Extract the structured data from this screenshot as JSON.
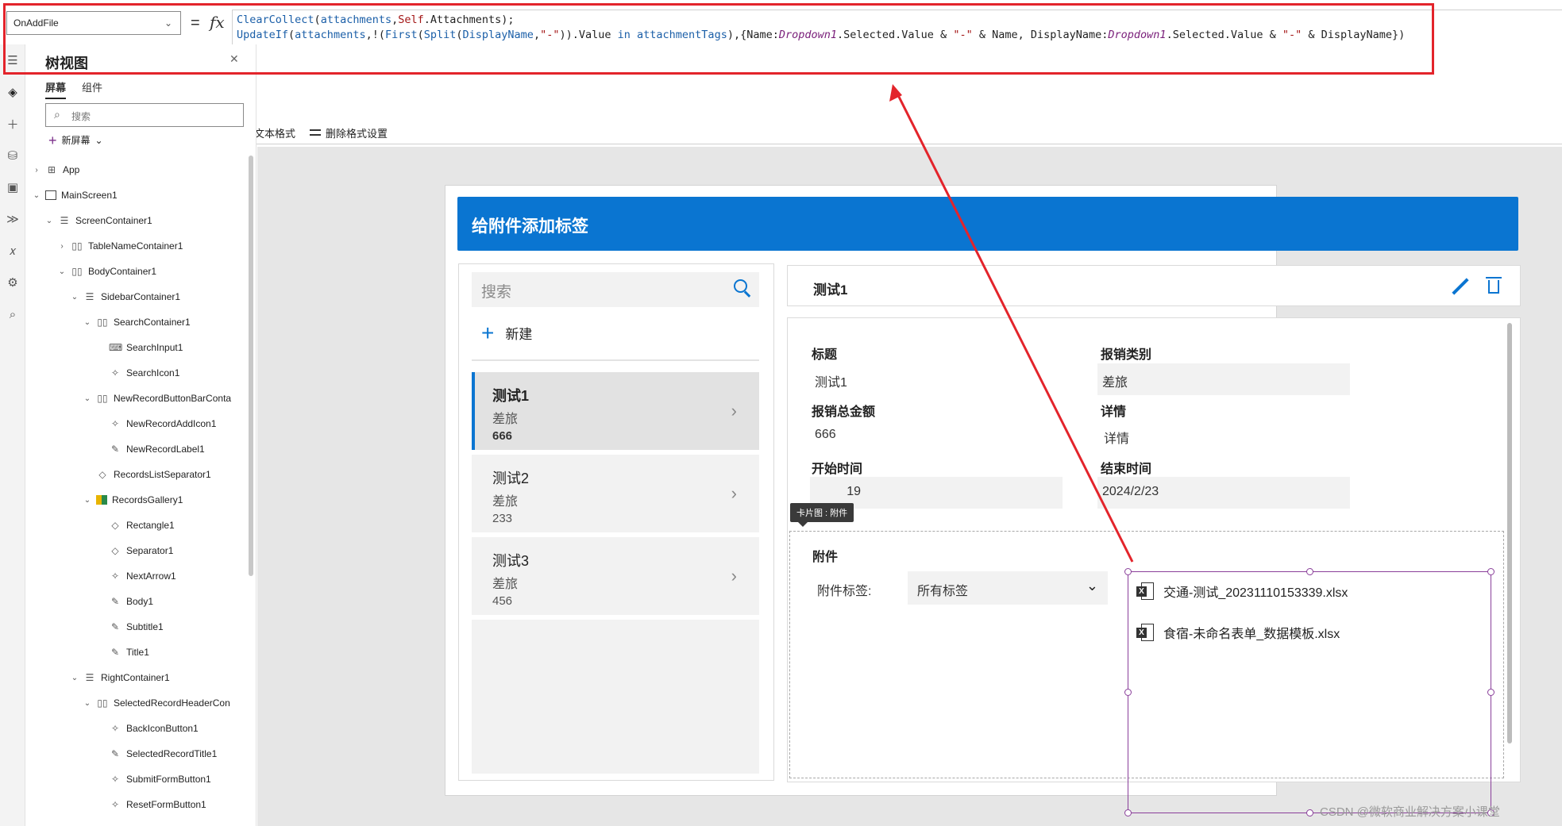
{
  "formula_bar": {
    "property": "OnAddFile",
    "equals": "=",
    "fx": "fx",
    "line1": [
      {
        "t": "ClearCollect",
        "c": "fn"
      },
      {
        "t": "(",
        "c": "plain"
      },
      {
        "t": "attachments",
        "c": "fn"
      },
      {
        "t": ",",
        "c": "plain"
      },
      {
        "t": "Self",
        "c": "str"
      },
      {
        "t": ".Attachments);",
        "c": "plain"
      }
    ],
    "line2": [
      {
        "t": "UpdateIf",
        "c": "fn"
      },
      {
        "t": "(",
        "c": "plain"
      },
      {
        "t": "attachments",
        "c": "fn"
      },
      {
        "t": ",!(",
        "c": "plain"
      },
      {
        "t": "First",
        "c": "fn"
      },
      {
        "t": "(",
        "c": "plain"
      },
      {
        "t": "Split",
        "c": "fn"
      },
      {
        "t": "(",
        "c": "plain"
      },
      {
        "t": "DisplayName",
        "c": "fn"
      },
      {
        "t": ",",
        "c": "plain"
      },
      {
        "t": "\"-\"",
        "c": "str"
      },
      {
        "t": ")).Value ",
        "c": "plain"
      },
      {
        "t": "in",
        "c": "kw"
      },
      {
        "t": " ",
        "c": "plain"
      },
      {
        "t": "attachmentTags",
        "c": "fn"
      },
      {
        "t": "),{Name:",
        "c": "plain"
      },
      {
        "t": "Dropdown1",
        "c": "ctl"
      },
      {
        "t": ".Selected.Value & ",
        "c": "plain"
      },
      {
        "t": "\"-\"",
        "c": "str"
      },
      {
        "t": " & Name, DisplayName:",
        "c": "plain"
      },
      {
        "t": "Dropdown1",
        "c": "ctl"
      },
      {
        "t": ".Selected.Value & ",
        "c": "plain"
      },
      {
        "t": "\"-\"",
        "c": "str"
      },
      {
        "t": " & DisplayName})",
        "c": "plain"
      }
    ],
    "format_text": "文本格式",
    "remove_format": "删除格式设置"
  },
  "tree": {
    "title": "树视图",
    "tabs": [
      "屏幕",
      "组件"
    ],
    "search_placeholder": "搜索",
    "new_screen": "新屏幕",
    "nodes": [
      {
        "label": "App",
        "indent": 0,
        "caret": "›",
        "icon": "app"
      },
      {
        "label": "MainScreen1",
        "indent": 0,
        "caret": "⌄",
        "icon": "screen"
      },
      {
        "label": "ScreenContainer1",
        "indent": 1,
        "caret": "⌄",
        "icon": "vcontainer"
      },
      {
        "label": "TableNameContainer1",
        "indent": 2,
        "caret": "›",
        "icon": "hcontainer"
      },
      {
        "label": "BodyContainer1",
        "indent": 2,
        "caret": "⌄",
        "icon": "hcontainer"
      },
      {
        "label": "SidebarContainer1",
        "indent": 3,
        "caret": "⌄",
        "icon": "vcontainer"
      },
      {
        "label": "SearchContainer1",
        "indent": 4,
        "caret": "⌄",
        "icon": "hcontainer"
      },
      {
        "label": "SearchInput1",
        "indent": 5,
        "caret": "",
        "icon": "input"
      },
      {
        "label": "SearchIcon1",
        "indent": 5,
        "caret": "",
        "icon": "iconctl"
      },
      {
        "label": "NewRecordButtonBarConta",
        "indent": 4,
        "caret": "⌄",
        "icon": "hcontainer"
      },
      {
        "label": "NewRecordAddIcon1",
        "indent": 5,
        "caret": "",
        "icon": "iconctl"
      },
      {
        "label": "NewRecordLabel1",
        "indent": 5,
        "caret": "",
        "icon": "label"
      },
      {
        "label": "RecordsListSeparator1",
        "indent": 4,
        "caret": "",
        "icon": "shape"
      },
      {
        "label": "RecordsGallery1",
        "indent": 4,
        "caret": "⌄",
        "icon": "gallery"
      },
      {
        "label": "Rectangle1",
        "indent": 5,
        "caret": "",
        "icon": "shape"
      },
      {
        "label": "Separator1",
        "indent": 5,
        "caret": "",
        "icon": "shape"
      },
      {
        "label": "NextArrow1",
        "indent": 5,
        "caret": "",
        "icon": "iconctl"
      },
      {
        "label": "Body1",
        "indent": 5,
        "caret": "",
        "icon": "label"
      },
      {
        "label": "Subtitle1",
        "indent": 5,
        "caret": "",
        "icon": "label"
      },
      {
        "label": "Title1",
        "indent": 5,
        "caret": "",
        "icon": "label"
      },
      {
        "label": "RightContainer1",
        "indent": 3,
        "caret": "⌄",
        "icon": "vcontainer"
      },
      {
        "label": "SelectedRecordHeaderCon",
        "indent": 4,
        "caret": "⌄",
        "icon": "hcontainer"
      },
      {
        "label": "BackIconButton1",
        "indent": 5,
        "caret": "",
        "icon": "iconctl"
      },
      {
        "label": "SelectedRecordTitle1",
        "indent": 5,
        "caret": "",
        "icon": "label"
      },
      {
        "label": "SubmitFormButton1",
        "indent": 5,
        "caret": "",
        "icon": "iconctl"
      },
      {
        "label": "ResetFormButton1",
        "indent": 5,
        "caret": "",
        "icon": "iconctl"
      }
    ]
  },
  "app": {
    "header_title": "给附件添加标签",
    "search_placeholder": "搜索",
    "new_label": "新建",
    "records": [
      {
        "title": "测试1",
        "subtitle": "差旅",
        "body": "666",
        "selected": true
      },
      {
        "title": "测试2",
        "subtitle": "差旅",
        "body": "233",
        "selected": false
      },
      {
        "title": "测试3",
        "subtitle": "差旅",
        "body": "456",
        "selected": false
      }
    ],
    "detail_title": "测试1",
    "fields": {
      "title_label": "标题",
      "title_value": "测试1",
      "type_label": "报销类别",
      "type_value": "差旅",
      "amount_label": "报销总金额",
      "amount_value": "666",
      "detail_label": "详情",
      "detail_value": "详情",
      "start_label": "开始时间",
      "start_value": "19",
      "end_label": "结束时间",
      "end_value": "2024/2/23"
    },
    "tooltip": "卡片图 : 附件",
    "attachments": {
      "label": "附件",
      "tag_label": "附件标签:",
      "tag_selected": "所有标签",
      "files": [
        "交通-测试_20231110153339.xlsx",
        "食宿-未命名表单_数据模板.xlsx"
      ]
    }
  },
  "watermark": "CSDN @微软商业解决方案小课堂",
  "colors": {
    "accent": "#0a75d1",
    "annotation": "#e3242b",
    "selection": "#8a3f9a"
  }
}
